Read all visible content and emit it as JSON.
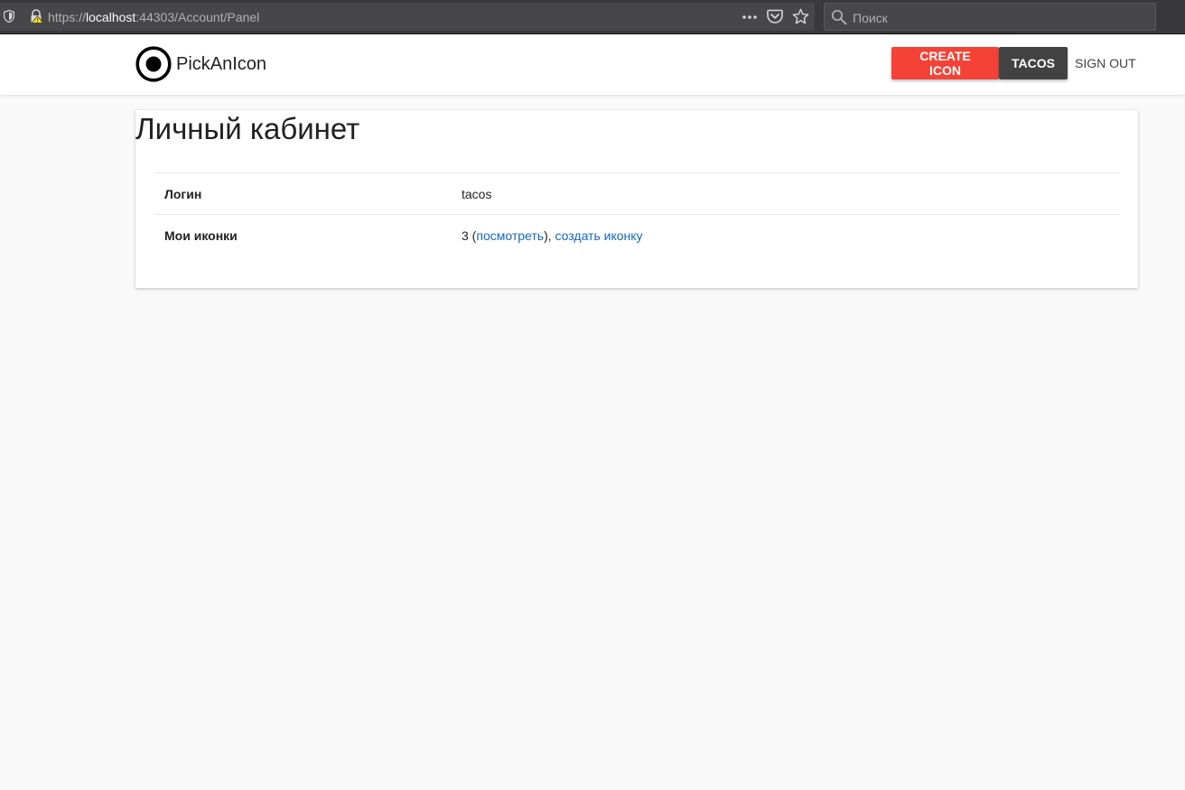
{
  "browser": {
    "url_scheme": "https://",
    "url_host": "localhost",
    "url_rest": ":44303/Account/Panel",
    "search_placeholder": "Поиск"
  },
  "header": {
    "brand_name": "PickAnIcon",
    "create_button": "CREATE ICON",
    "user_button": "TACOS",
    "signout_link": "SIGN OUT",
    "colors": {
      "create": "#f44336",
      "user": "#424242"
    }
  },
  "panel": {
    "title": "Личный кабинет",
    "rows": [
      {
        "label": "Логин",
        "value": "tacos"
      },
      {
        "label": "Мои иконки",
        "count": "3",
        "open_paren": " (",
        "view_link": "посмотреть",
        "separator": "), ",
        "create_link": "создать иконку"
      }
    ]
  },
  "icons": {
    "shield": "tracking-protection-shield-icon",
    "lock": "insecure-lock-warning-icon",
    "more": "page-actions-more-icon",
    "pocket": "pocket-icon",
    "star": "bookmark-star-icon",
    "search": "search-icon",
    "logo": "target-logo-icon"
  }
}
